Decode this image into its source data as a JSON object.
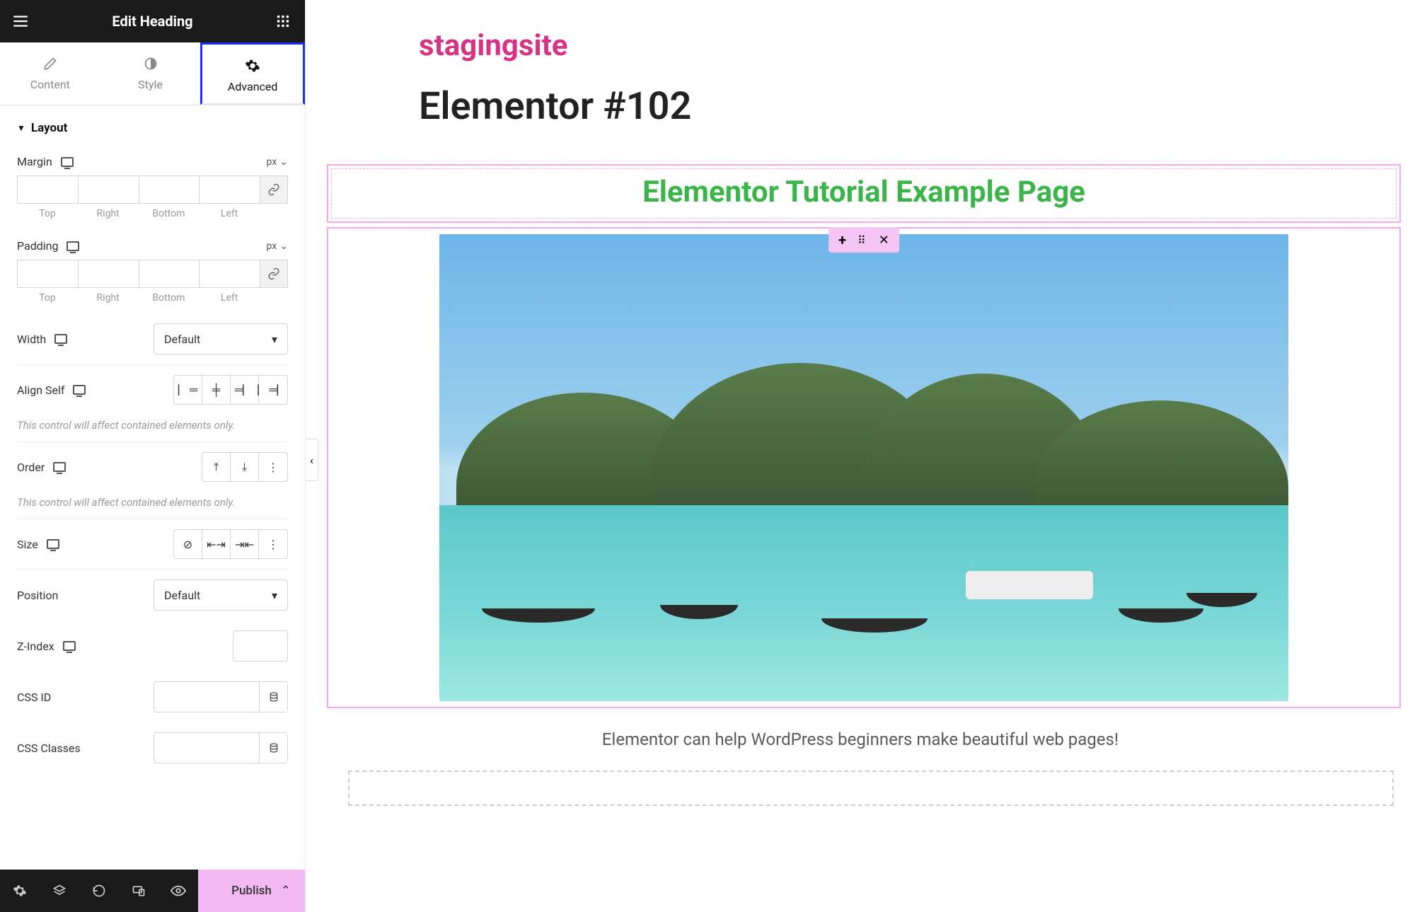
{
  "panel": {
    "title": "Edit Heading",
    "tabs": {
      "content": "Content",
      "style": "Style",
      "advanced": "Advanced"
    }
  },
  "section": {
    "layout": "Layout"
  },
  "margin": {
    "label": "Margin",
    "unit": "px",
    "top": "Top",
    "right": "Right",
    "bottom": "Bottom",
    "left": "Left"
  },
  "padding": {
    "label": "Padding",
    "unit": "px",
    "top": "Top",
    "right": "Right",
    "bottom": "Bottom",
    "left": "Left"
  },
  "width": {
    "label": "Width",
    "value": "Default"
  },
  "align_self": {
    "label": "Align Self",
    "hint": "This control will affect contained elements only."
  },
  "order": {
    "label": "Order",
    "hint": "This control will affect contained elements only."
  },
  "size": {
    "label": "Size"
  },
  "position": {
    "label": "Position",
    "value": "Default"
  },
  "zindex": {
    "label": "Z-Index"
  },
  "css_id": {
    "label": "CSS ID"
  },
  "css_classes": {
    "label": "CSS Classes"
  },
  "footer": {
    "publish": "Publish"
  },
  "canvas": {
    "site_title": "stagingsite",
    "post_title": "Elementor #102",
    "heading_text": "Elementor Tutorial Example Page",
    "caption": "Elementor can help WordPress beginners make beautiful web pages!"
  }
}
